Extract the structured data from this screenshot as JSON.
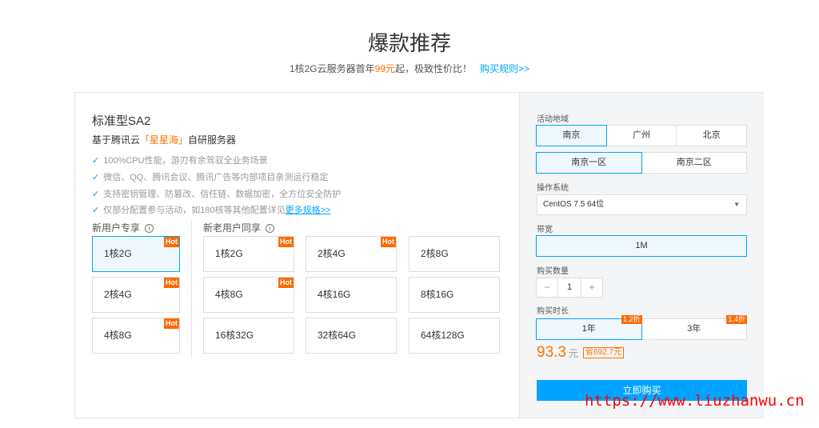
{
  "header": {
    "title": "爆款推荐",
    "sub_pre": "1核2G云服务器首年",
    "sub_price": "99元",
    "sub_post": "起，极致性价比！",
    "rules_link": "购买规则>>"
  },
  "product": {
    "title": "标准型SA2",
    "desc_pre": "基于腾讯云",
    "desc_hl": "「星星海」",
    "desc_post": "自研服务器",
    "features": [
      "100%CPU性能，游刃有余驾驭全业务场景",
      "微信、QQ、腾讯会议、腾讯广告等内部项目亲测运行稳定",
      "支持密钥管理、防篡改、信任链、数据加密，全方位安全防护",
      "仅部分配置参与活动，如180核等其他配置详见"
    ],
    "more_link": "更多规格>>"
  },
  "new_user": {
    "label": "新用户专享",
    "options": [
      {
        "label": "1核2G",
        "hot": "Hot"
      },
      {
        "label": "2核4G",
        "hot": "Hot"
      },
      {
        "label": "4核8G",
        "hot": "Hot"
      }
    ]
  },
  "all_user": {
    "label": "新老用户同享",
    "options": [
      {
        "label": "1核2G",
        "hot": "Hot"
      },
      {
        "label": "2核4G",
        "hot": "Hot"
      },
      {
        "label": "2核8G"
      },
      {
        "label": "4核8G",
        "hot": "Hot"
      },
      {
        "label": "4核16G"
      },
      {
        "label": "8核16G"
      },
      {
        "label": "16核32G"
      },
      {
        "label": "32核64G"
      },
      {
        "label": "64核128G"
      }
    ]
  },
  "config": {
    "region_label": "活动地域",
    "regions": [
      "南京",
      "广州",
      "北京"
    ],
    "zones": [
      "南京一区",
      "南京二区"
    ],
    "os_label": "操作系统",
    "os_value": "CentOS 7.5 64位",
    "bw_label": "带宽",
    "bw_value": "1M",
    "qty_label": "购买数量",
    "qty_minus": "−",
    "qty_value": "1",
    "qty_plus": "+",
    "dur_label": "购买时长",
    "durations": [
      {
        "label": "1年",
        "discount": "1.2折"
      },
      {
        "label": "3年",
        "discount": "1.4折"
      }
    ],
    "price": "93.3",
    "unit": "元",
    "save": "省692.7元",
    "buy": "立即购买"
  },
  "watermark": "https://www.liuzhanwu.cn"
}
